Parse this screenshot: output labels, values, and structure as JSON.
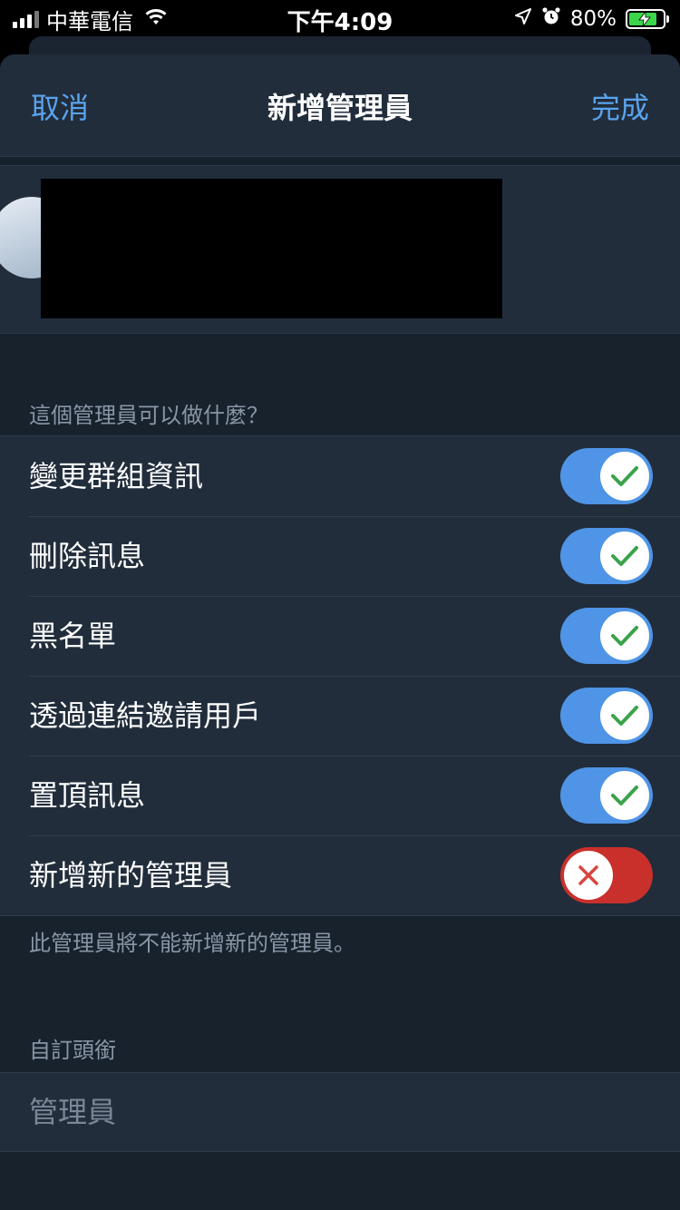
{
  "status_bar": {
    "carrier": "中華電信",
    "time": "下午4:09",
    "battery": "80%",
    "battery_level": 0.8,
    "charging": true
  },
  "nav": {
    "cancel": "取消",
    "title": "新增管理員",
    "done": "完成"
  },
  "permissions": {
    "header": "這個管理員可以做什麼？",
    "items": [
      {
        "label": "變更群組資訊",
        "enabled": true
      },
      {
        "label": "刪除訊息",
        "enabled": true
      },
      {
        "label": "黑名單",
        "enabled": true
      },
      {
        "label": "透過連結邀請用戶",
        "enabled": true
      },
      {
        "label": "置頂訊息",
        "enabled": true
      },
      {
        "label": "新增新的管理員",
        "enabled": false
      }
    ],
    "footer": "此管理員將不能新增新的管理員。"
  },
  "custom_title": {
    "header": "自訂頭銜",
    "placeholder": "管理員"
  },
  "colors": {
    "accent": "#5aa3ee",
    "toggle_on": "#4f94e6",
    "toggle_off": "#c9302c",
    "check": "#3aa34a",
    "cross": "#d9443f"
  }
}
